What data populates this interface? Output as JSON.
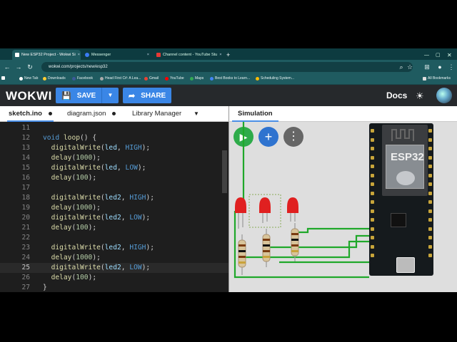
{
  "browser": {
    "tabs": [
      {
        "label": "New ESP32 Project - Wokwi Si",
        "active": true,
        "favicon_color": "#ffffff"
      },
      {
        "label": "Messenger",
        "active": false,
        "favicon_color": "#3b7cf5"
      },
      {
        "label": "Channel content - YouTube Stu",
        "active": false,
        "favicon_color": "#e53935"
      }
    ],
    "new_tab_symbol": "+",
    "url": "wokwi.com/projects/new/esp32",
    "bookmarks": [
      {
        "label": "New Tab",
        "color": "#ffffff"
      },
      {
        "label": "Downloads",
        "color": "#ffcc33"
      },
      {
        "label": "Facebook",
        "color": "#3b5998"
      },
      {
        "label": "Head First C#: A Lea...",
        "color": "#aaaaaa"
      },
      {
        "label": "Gmail",
        "color": "#ea4335"
      },
      {
        "label": "YouTube",
        "color": "#ff0000"
      },
      {
        "label": "Maps",
        "color": "#34a853"
      },
      {
        "label": "Best Books to Learn...",
        "color": "#4285f4"
      },
      {
        "label": "Scheduling System...",
        "color": "#fbbc04"
      }
    ],
    "all_bookmarks": "All Bookmarks"
  },
  "toolbar": {
    "logo": "WOKWI",
    "save_label": "SAVE",
    "share_label": "SHARE",
    "docs_label": "Docs",
    "accent": "#3a86e6"
  },
  "editor": {
    "tabs": [
      {
        "label": "sketch.ino",
        "active": true,
        "modified": true
      },
      {
        "label": "diagram.json",
        "active": false,
        "modified": true
      },
      {
        "label": "Library Manager",
        "active": false,
        "modified": false
      }
    ],
    "current_line": "25",
    "lines": [
      {
        "n": "11",
        "code": ""
      },
      {
        "n": "12",
        "code": "void loop() {"
      },
      {
        "n": "13",
        "code": "  digitalWrite(led, HIGH);"
      },
      {
        "n": "14",
        "code": "  delay(1000);"
      },
      {
        "n": "15",
        "code": "  digitalWrite(led, LOW);"
      },
      {
        "n": "16",
        "code": "  delay(100);"
      },
      {
        "n": "17",
        "code": ""
      },
      {
        "n": "18",
        "code": "  digitalWrite(led2, HIGH);"
      },
      {
        "n": "19",
        "code": "  delay(1000);"
      },
      {
        "n": "20",
        "code": "  digitalWrite(led2, LOW);"
      },
      {
        "n": "21",
        "code": "  delay(100);"
      },
      {
        "n": "22",
        "code": ""
      },
      {
        "n": "23",
        "code": "  digitalWrite(led2, HIGH);"
      },
      {
        "n": "24",
        "code": "  delay(1000);"
      },
      {
        "n": "25",
        "code": "  digitalWrite(led2, LOW);"
      },
      {
        "n": "26",
        "code": "  delay(100);"
      },
      {
        "n": "27",
        "code": "}"
      }
    ]
  },
  "simulation": {
    "tab_label": "Simulation",
    "board_label": "ESP32",
    "play_color": "#2eab4a",
    "add_color": "#2f73cf",
    "more_color": "#666666",
    "led_color": "#e02020",
    "wire_color": "#1fa82a"
  }
}
